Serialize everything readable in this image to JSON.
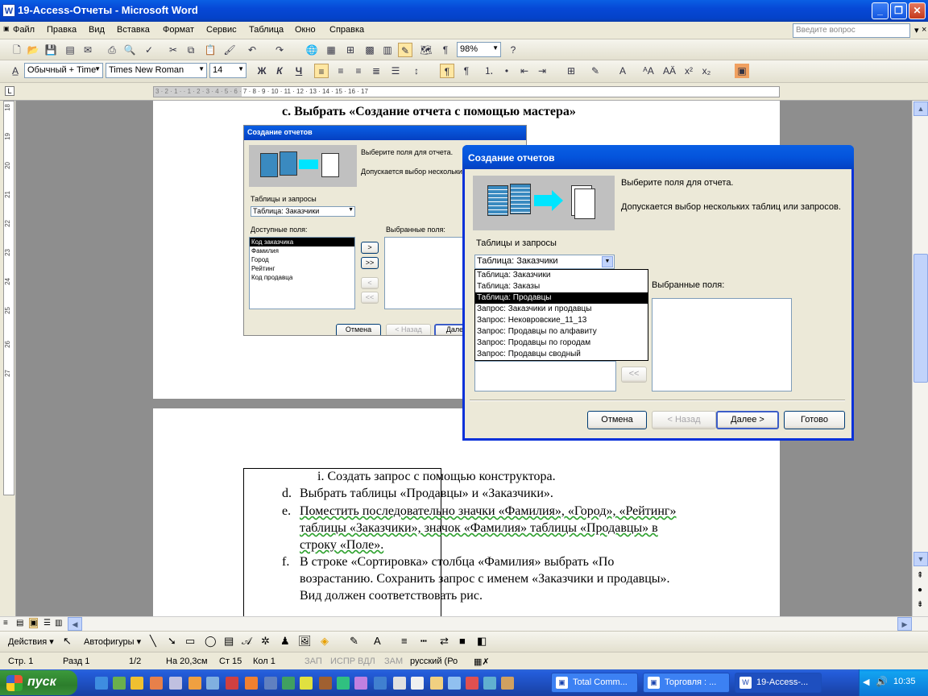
{
  "window": {
    "title": "19-Access-Отчеты - Microsoft Word",
    "app_icon": "W"
  },
  "menu": {
    "items": [
      "Файл",
      "Правка",
      "Вид",
      "Вставка",
      "Формат",
      "Сервис",
      "Таблица",
      "Окно",
      "Справка"
    ],
    "ask_placeholder": "Введите вопрос"
  },
  "toolbar": {
    "zoom": "98%",
    "style": "Обычный + Time",
    "font": "Times New Roman",
    "size": "14",
    "bold": "Ж",
    "italic": "К",
    "underline": "Ч"
  },
  "ruler": {
    "ticks": "3 · 2 · 1 · · 1 · 2 · 3 · 4 · 5 · 6 · 7 · 8 · 9 · 10 · 11 · 12 · 13 · 14 · 15 · 16 · 17",
    "vticks": [
      "18",
      "19",
      "20",
      "21",
      "22",
      "23",
      "24",
      "25",
      "26",
      "27"
    ]
  },
  "document": {
    "line_c": "c.  Выбрать «Создание отчета с помощью мастера»",
    "line_i": "i.   Создать запрос с помощью конструктора.",
    "line_d_marker": "d.",
    "line_d": "Выбрать таблицы «Продавцы» и «Заказчики».",
    "line_e_marker": "e.",
    "line_e1": "Поместить последовательно значки «Фамилия», «Город», «Рейтинг»",
    "line_e2": "таблицы «Заказчики», значок «Фамилия» таблицы «Продавцы» в",
    "line_e3": "строку «Поле».",
    "line_f_marker": "f.",
    "line_f1": "В строке «Сортировка» столбца «Фамилия» выбрать «По",
    "line_f2": "возрастанию. Сохранить запрос с именем «Заказчики и продавцы».",
    "line_f3": "Вид должен соответствовать рис."
  },
  "small_dialog": {
    "title": "Создание отчетов",
    "hint1": "Выберите поля для отчета.",
    "hint2": "Допускается выбор нескольких",
    "tables_label": "Таблицы и запросы",
    "tables_value": "Таблица: Заказчики",
    "available_label": "Доступные поля:",
    "selected_label": "Выбранные поля:",
    "fields": [
      "Код заказчика",
      "Фамилия",
      "Город",
      "Рейтинг",
      "Код продавца"
    ],
    "btn_add": ">",
    "btn_add_all": ">>",
    "btn_remove": "<",
    "btn_remove_all": "<<",
    "cancel": "Отмена",
    "back": "< Назад",
    "next": "Далее"
  },
  "big_dialog": {
    "title": "Создание отчетов",
    "hint1": "Выберите поля для отчета.",
    "hint2": "Допускается выбор нескольких таблиц или запросов.",
    "tables_label": "Таблицы и запросы",
    "tables_value": "Таблица: Заказчики",
    "selected_label": "Выбранные поля:",
    "dropdown_options": [
      "Таблица: Заказчики",
      "Таблица: Заказы",
      "Таблица: Продавцы",
      "Запрос: Заказчики и продавцы",
      "Запрос: Нековровские_11_13",
      "Запрос: Продавцы по алфавиту",
      "Запрос: Продавцы по городам",
      "Запрос: Продавцы сводный"
    ],
    "highlighted_index": 2,
    "btn_remove_all": "<<",
    "cancel": "Отмена",
    "back": "< Назад",
    "next": "Далее >",
    "finish": "Готово"
  },
  "draw": {
    "actions": "Действия ▾",
    "autoshapes": "Автофигуры ▾"
  },
  "status": {
    "page": "Стр.  1",
    "section": "Разд  1",
    "pages": "1/2",
    "at": "На 20,3см",
    "line": "Ст  15",
    "col": "Кол  1",
    "rec": "ЗАП",
    "trk": "ИСПР",
    "ext": "ВДЛ",
    "ovr": "ЗАМ",
    "lang": "русский (Ро"
  },
  "taskbar": {
    "start": "пуск",
    "tasks": [
      "Total Comm...",
      "Торговля : ...",
      "19-Access-..."
    ],
    "clock": "10:35"
  },
  "colors": {
    "xp_blue": "#0A5FE4",
    "start_green": "#3C9A3C",
    "selection": "#000000"
  }
}
